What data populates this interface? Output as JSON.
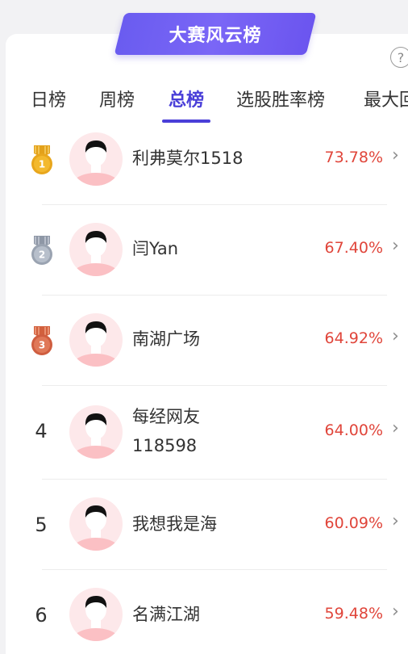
{
  "banner": {
    "title": "大赛风云榜"
  },
  "help": {
    "glyph": "?"
  },
  "tabs": [
    {
      "label": "日榜"
    },
    {
      "label": "周榜"
    },
    {
      "label": "总榜"
    },
    {
      "label": "选股胜率榜"
    },
    {
      "label": "最大回"
    }
  ],
  "active_tab": "总榜",
  "colors": {
    "accent": "#4a3fd8",
    "rate": "#e0453a",
    "banner": "#6a5cf0"
  },
  "rows": [
    {
      "rank": "1",
      "medal": "gold-medal-icon",
      "name": "利弗莫尔1518",
      "rate": "73.78%"
    },
    {
      "rank": "2",
      "medal": "silver-medal-icon",
      "name": "闫Yan",
      "rate": "67.40%"
    },
    {
      "rank": "3",
      "medal": "bronze-medal-icon",
      "name": "南湖广场",
      "rate": "64.92%"
    },
    {
      "rank": "4",
      "medal": "",
      "name": "每经网友",
      "name_line2": "118598",
      "rate": "64.00%"
    },
    {
      "rank": "5",
      "medal": "",
      "name": "我想我是海",
      "rate": "60.09%"
    },
    {
      "rank": "6",
      "medal": "",
      "name": "名满江湖",
      "rate": "59.48%"
    }
  ],
  "chevron": "›"
}
